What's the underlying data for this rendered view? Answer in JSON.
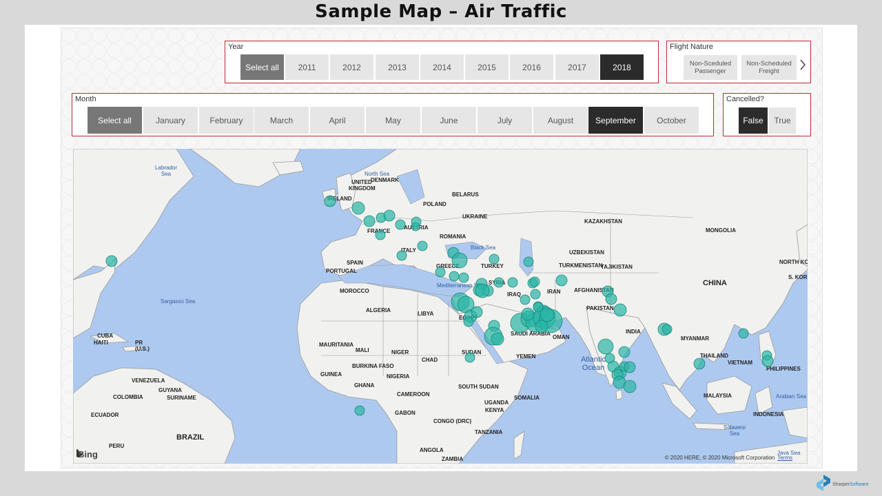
{
  "page": {
    "title": "Sample Map – Air Traffic"
  },
  "year_slicer": {
    "title": "Year",
    "items": [
      "Select all",
      "2011",
      "2012",
      "2013",
      "2014",
      "2015",
      "2016",
      "2017",
      "2018"
    ],
    "selected": "2018"
  },
  "flight_nature_slicer": {
    "title": "Flight Nature",
    "items": [
      {
        "line1": "Non-Sceduled",
        "line2": "Passenger"
      },
      {
        "line1": "Non-Scheduled",
        "line2": "Freight"
      }
    ],
    "next_icon": "chevron-right-icon"
  },
  "month_slicer": {
    "title": "Month",
    "items": [
      "Select all",
      "January",
      "February",
      "March",
      "April",
      "May",
      "June",
      "July",
      "August",
      "September",
      "October"
    ],
    "selected": "September"
  },
  "cancelled_slicer": {
    "title": "Cancelled?",
    "items": [
      "False",
      "True"
    ],
    "selected": "False"
  },
  "map": {
    "logo_text": "Bing",
    "copyright": "© 2020 HERE, © 2020 Microsoft Corporation",
    "terms": "Terms",
    "marker_color": "#2ab5a5",
    "countries": [
      "UNITED KINGDOM",
      "DENMARK",
      "BELARUS",
      "IRELAND",
      "POLAND",
      "UKRAINE",
      "KAZAKHSTAN",
      "MONGOLIA",
      "FRANCE",
      "AUSTRIA",
      "ROMANIA",
      "ITALY",
      "UZBEKISTAN",
      "SPAIN",
      "PORTUGAL",
      "GREECE",
      "TURKEY",
      "TURKMENISTAN",
      "TAJIKISTAN",
      "NORTH KOREA",
      "S. KOREA",
      "MOROCCO",
      "SYRIA",
      "IRAN",
      "AFGHANISTAN",
      "CHINA",
      "IRAQ",
      "ALGERIA",
      "LIBYA",
      "EGYPT",
      "PAKISTAN",
      "SAUDI ARABIA",
      "OMAN",
      "INDIA",
      "MYANMAR",
      "CUBA",
      "HAITI",
      "PR (U.S.)",
      "MAURITANIA",
      "MALI",
      "NIGER",
      "CHAD",
      "SUDAN",
      "YEMEN",
      "THAILAND",
      "VIETNAM",
      "BURKINA FASO",
      "GUINEA",
      "NIGERIA",
      "PHILIPPINES",
      "VENEZUELA",
      "GUYANA",
      "SURINAME",
      "GHANA",
      "SOUTH SUDAN",
      "COLOMBIA",
      "CAMEROON",
      "SOMALIA",
      "MALAYSIA",
      "UGANDA",
      "ECUADOR",
      "GABON",
      "KENYA",
      "CONGO (DRC)",
      "INDONESIA",
      "TANZANIA",
      "BRAZIL",
      "PERU",
      "ANGOLA",
      "ZAMBIA"
    ],
    "seas": [
      "Labrador Sea",
      "North Sea",
      "Black Sea",
      "Mediterranean Sea",
      "Sargasso Sea",
      "Atlantic Ocean",
      "Arabian Sea",
      "Sulawesi Sea",
      "Java Sea",
      "Timor Sea",
      "Philippi"
    ]
  },
  "branding": {
    "company_part1": "Sharper",
    "company_part2": "Software"
  }
}
